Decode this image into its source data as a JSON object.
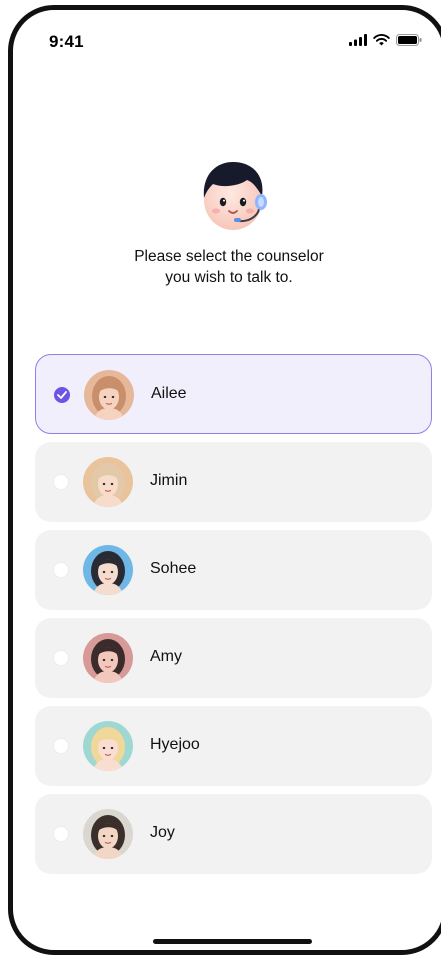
{
  "status_bar": {
    "time": "9:41",
    "icons": [
      "signal-icon",
      "wifi-icon",
      "battery-icon"
    ]
  },
  "mascot": {
    "icon": "counselor-mascot-icon"
  },
  "prompt": {
    "line1": "Please select the counselor",
    "line2": "you wish to talk to."
  },
  "counselors": [
    {
      "name": "Ailee",
      "selected": true,
      "avatar_bg": "#e7b79a",
      "hair": "#c98f6b",
      "skin": "#f6d3c0"
    },
    {
      "name": "Jimin",
      "selected": false,
      "avatar_bg": "#e9c39b",
      "hair": "#e4c9a8",
      "skin": "#f7dccb"
    },
    {
      "name": "Sohee",
      "selected": false,
      "avatar_bg": "#6fb7e6",
      "hair": "#2a2a33",
      "skin": "#f4dccf"
    },
    {
      "name": "Amy",
      "selected": false,
      "avatar_bg": "#d89a98",
      "hair": "#3b2b2a",
      "skin": "#f1c8bb"
    },
    {
      "name": "Hyejoo",
      "selected": false,
      "avatar_bg": "#9fd8d2",
      "hair": "#f2d79a",
      "skin": "#f8ddd0"
    },
    {
      "name": "Joy",
      "selected": false,
      "avatar_bg": "#d9d7cf",
      "hair": "#3a2f2a",
      "skin": "#f3d7c6"
    }
  ],
  "colors": {
    "accent": "#6a55e6",
    "selected_bg": "#f1effc",
    "selected_border": "#8d82e8",
    "item_bg": "#f2f2f3"
  }
}
